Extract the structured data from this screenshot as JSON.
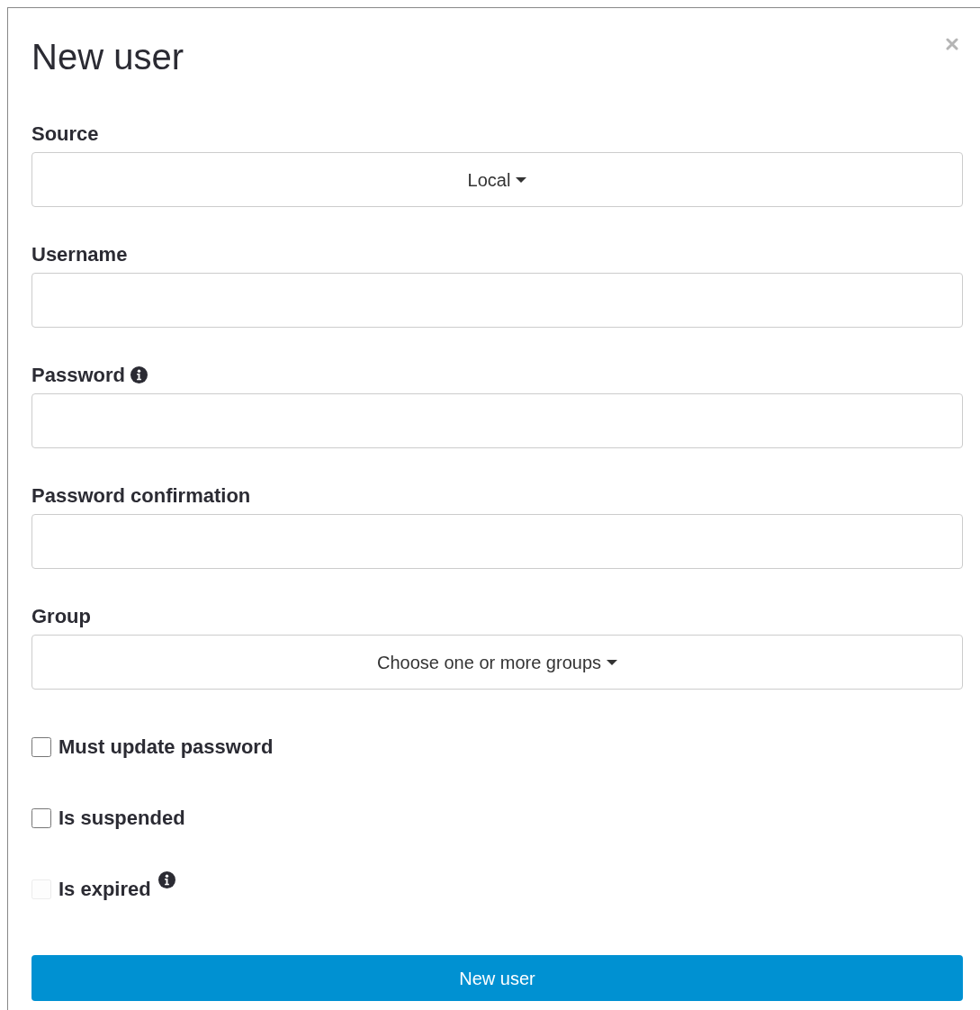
{
  "dialog": {
    "title": "New user"
  },
  "fields": [
    {
      "kind": "dropdown",
      "label": "Source",
      "info": false,
      "value": "Local"
    },
    {
      "kind": "text",
      "label": "Username",
      "info": false
    },
    {
      "kind": "password",
      "label": "Password",
      "info": true
    },
    {
      "kind": "password",
      "label": "Password confirmation",
      "info": false
    },
    {
      "kind": "dropdown",
      "label": "Group",
      "info": false,
      "placeholder": "Choose one or more groups"
    }
  ],
  "checkboxes": [
    {
      "label": "Must update password",
      "checked": false,
      "disabled": false,
      "info": false
    },
    {
      "label": "Is suspended",
      "checked": false,
      "disabled": false,
      "info": false
    },
    {
      "label": "Is expired",
      "checked": false,
      "disabled": true,
      "info": true
    }
  ],
  "submit_button": "New user"
}
